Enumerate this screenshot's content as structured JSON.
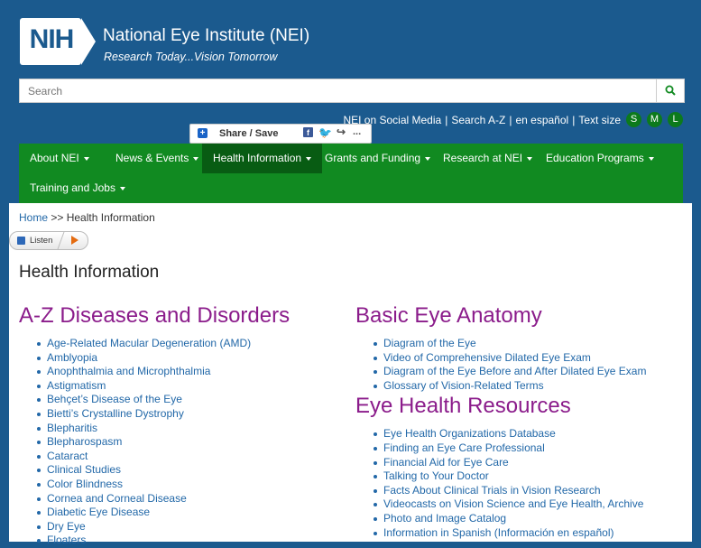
{
  "header": {
    "logo_text": "NIH",
    "title": "National Eye Institute (NEI)",
    "tagline": "Research Today...Vision Tomorrow"
  },
  "search": {
    "placeholder": "Search"
  },
  "utility": {
    "social": "NEI on Social Media",
    "az": "Search A-Z",
    "espanol": "en español",
    "text_size_label": "Text size",
    "sizes": [
      "S",
      "M",
      "L"
    ]
  },
  "share": {
    "label": "Share / Save",
    "more": "..."
  },
  "nav": {
    "items": [
      {
        "label": "About NEI"
      },
      {
        "label": "News & Events"
      },
      {
        "label": "Health Information"
      },
      {
        "label": "Grants and Funding"
      },
      {
        "label": "Research at NEI"
      },
      {
        "label": "Education Programs"
      },
      {
        "label": "Training and Jobs"
      }
    ]
  },
  "breadcrumb": {
    "home": "Home",
    "sep": ">>",
    "current": "Health Information"
  },
  "listen": {
    "label": "Listen"
  },
  "page_title": "Health Information",
  "az_section": {
    "title": "A-Z Diseases and Disorders",
    "items": [
      "Age-Related Macular Degeneration (AMD)",
      "Amblyopia",
      "Anophthalmia and Microphthalmia",
      "Astigmatism",
      "Behçet’s Disease of the Eye",
      "Bietti’s Crystalline Dystrophy",
      "Blepharitis",
      "Blepharospasm",
      "Cataract",
      "Clinical Studies",
      "Color Blindness",
      "Cornea and Corneal Disease",
      "Diabetic Eye Disease",
      "Dry Eye",
      "Floaters"
    ]
  },
  "anatomy_section": {
    "title": "Basic Eye Anatomy",
    "items": [
      "Diagram of the Eye",
      "Video of Comprehensive Dilated Eye Exam",
      "Diagram of the Eye Before and After Dilated Eye Exam",
      "Glossary of Vision-Related Terms"
    ]
  },
  "resources_section": {
    "title": "Eye Health Resources",
    "items": [
      "Eye Health Organizations Database",
      "Finding an Eye Care Professional",
      "Financial Aid for Eye Care",
      "Talking to Your Doctor",
      "Facts About Clinical Trials in Vision Research",
      "Videocasts on Vision Science and Eye Health, Archive",
      "Photo and Image Catalog",
      "Information in Spanish (Información en español)"
    ]
  },
  "colors": {
    "header_blue": "#1b5a8e",
    "nav_green": "#118a21",
    "nav_active": "#085c13",
    "heading_purple": "#8b1c8b",
    "link_blue": "#2268a8"
  }
}
